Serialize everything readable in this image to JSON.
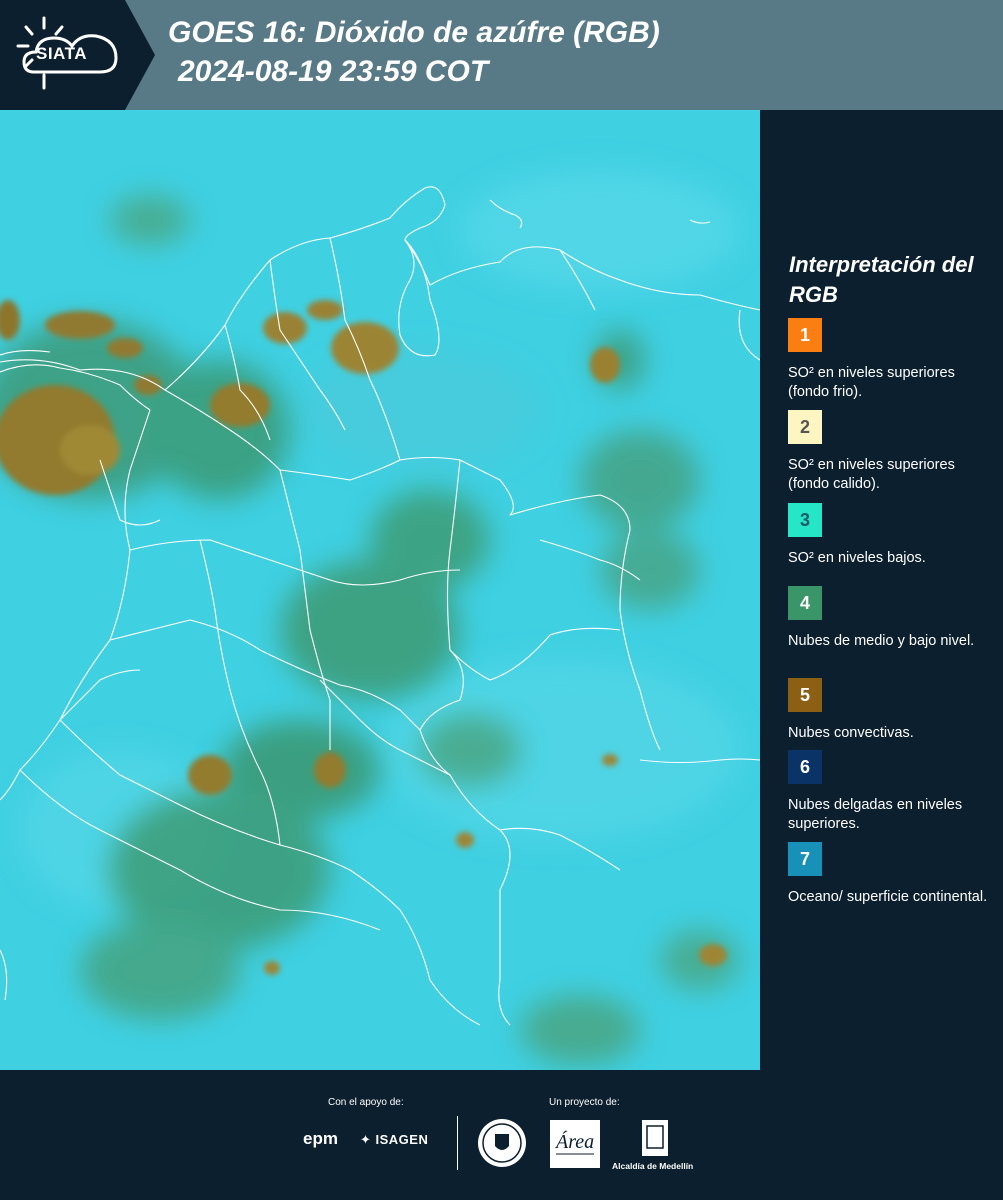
{
  "header": {
    "logo_text": "SIATA",
    "title_line1": "GOES 16: Dióxido de azúfre (RGB)",
    "title_line2": "2024-08-19 23:59 COT"
  },
  "map": {
    "background_color": "#3fd0e2",
    "border_color": "#ffffff"
  },
  "legend": {
    "title": "Interpretación del RGB",
    "items": [
      {
        "number": "1",
        "color": "#fa7e11",
        "text_color": "#ffffff",
        "text": "SO² en niveles superiores (fondo frio)."
      },
      {
        "number": "2",
        "color": "#fdf6c3",
        "text_color": "#555555",
        "text": "SO² en niveles superiores (fondo calido)."
      },
      {
        "number": "3",
        "color": "#25e6c6",
        "text_color": "#1a5a66",
        "text": "SO² en niveles bajos."
      },
      {
        "number": "4",
        "color": "#3a9668",
        "text_color": "#ffffff",
        "text": "Nubes de medio y bajo nivel."
      },
      {
        "number": "5",
        "color": "#8c6014",
        "text_color": "#ffffff",
        "text": "Nubes convectivas."
      },
      {
        "number": "6",
        "color": "#0a3468",
        "text_color": "#ffffff",
        "text": "Nubes delgadas en niveles superiores."
      },
      {
        "number": "7",
        "color": "#1791b8",
        "text_color": "#ffffff",
        "text": "Oceano/ superficie continental."
      }
    ]
  },
  "footer": {
    "support_label": "Con el apoyo de:",
    "project_label": "Un proyecto de:",
    "sponsor_1": "epm",
    "sponsor_2": "ISAGEN",
    "partner_area": "Área",
    "partner_alcaldia": "Alcaldía de Medellín"
  }
}
